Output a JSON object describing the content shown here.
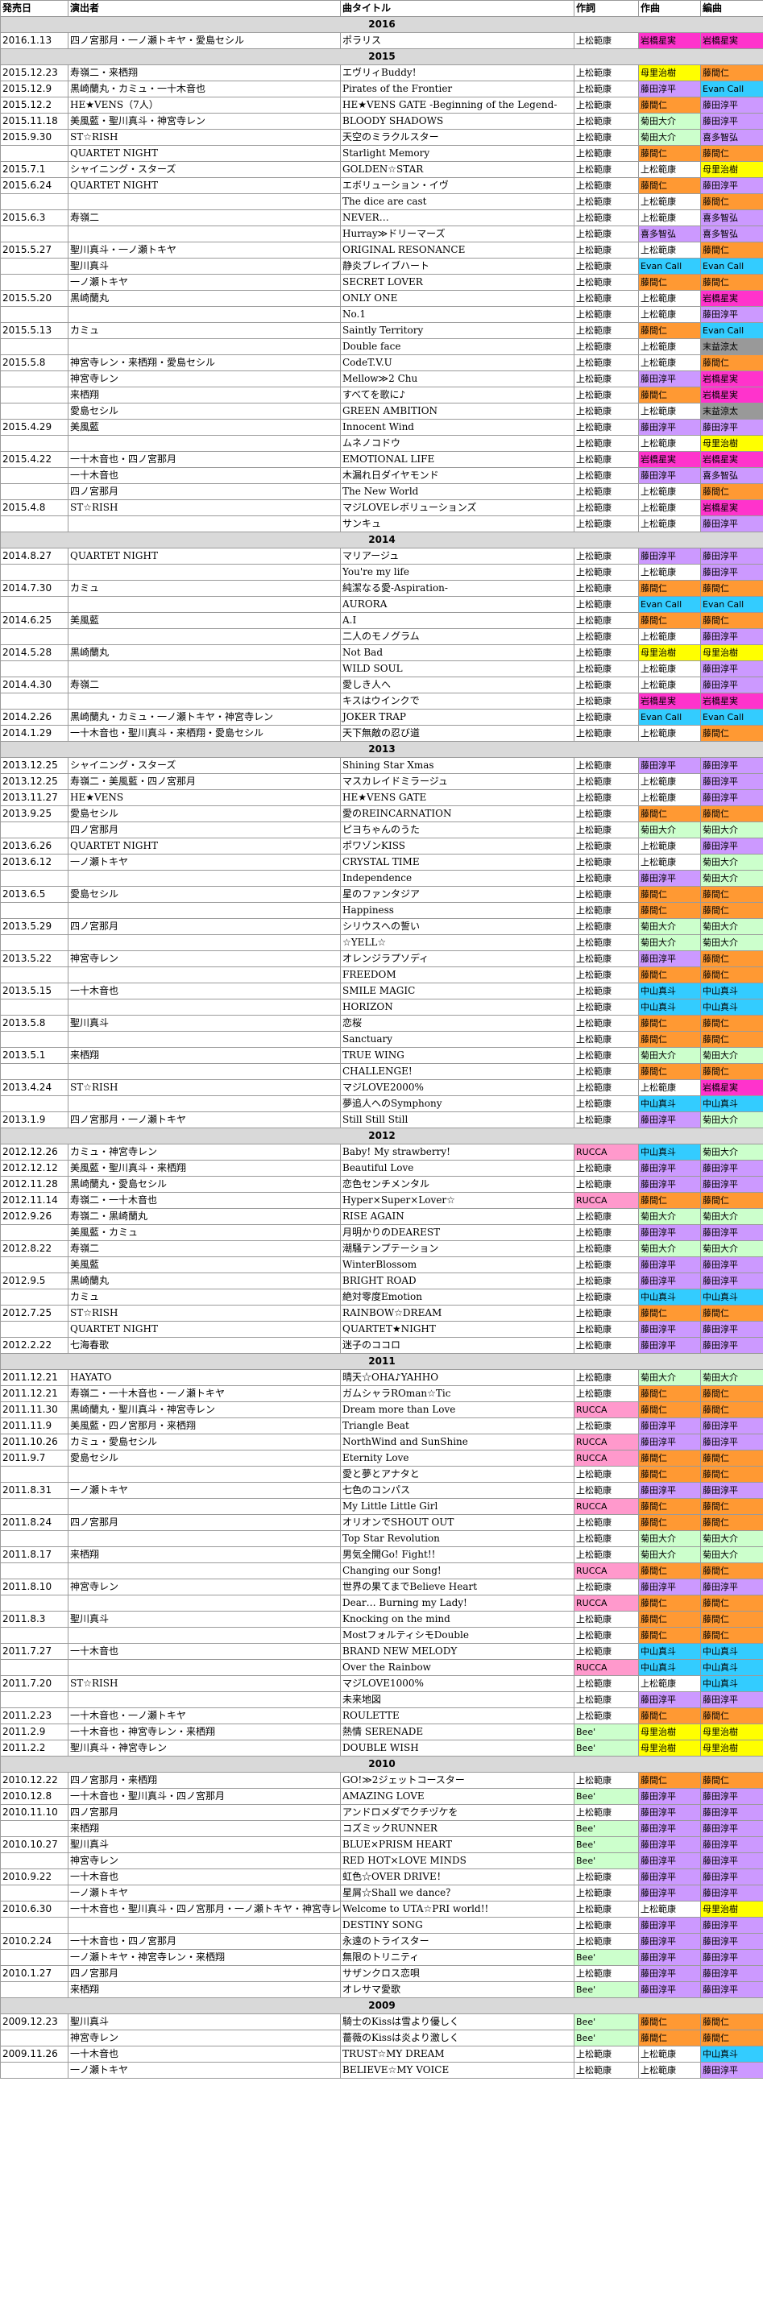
{
  "headers": [
    "発売日",
    "演出者",
    "曲タイトル",
    "作詞",
    "作曲",
    "編曲"
  ],
  "colors": {
    "上松範康": "#ffffff",
    "岩橋星実": "#ff33cc",
    "藤間仁": "#ff9933",
    "藤田淳平": "#cc99ff",
    "Evan Call": "#33ccff",
    "母里治樹": "#ffff00",
    "喜多智弘": "#cc99ff",
    "菊田大介": "#ccffcc",
    "末益涼太": "#999999",
    "中山真斗": "#33ccff",
    "RUCCA": "#ff99cc",
    "Bee'": "#ccffcc"
  },
  "groups": [
    {
      "year": "2016",
      "rows": [
        [
          "2016.1.13",
          "四ノ宮那月・一ノ瀬トキヤ・愛島セシル",
          "ポラリス",
          "上松範康",
          "岩橋星実",
          "岩橋星実"
        ]
      ]
    },
    {
      "year": "2015",
      "rows": [
        [
          "2015.12.23",
          "寿嶺二・来栖翔",
          "エヴリィBuddy!",
          "上松範康",
          "母里治樹",
          "藤間仁"
        ],
        [
          "2015.12.9",
          "黒崎蘭丸・カミュ・一十木音也",
          "Pirates of the Frontier",
          "上松範康",
          "藤田淳平",
          "Evan Call"
        ],
        [
          "2015.12.2",
          "HE★VENS（7人）",
          "HE★VENS GATE -Beginning of the Legend-",
          "上松範康",
          "藤間仁",
          "藤田淳平"
        ],
        [
          "2015.11.18",
          "美風藍・聖川真斗・神宮寺レン",
          "BLOODY SHADOWS",
          "上松範康",
          "菊田大介",
          "藤田淳平"
        ],
        [
          "2015.9.30",
          "ST☆RISH",
          "天空のミラクルスター",
          "上松範康",
          "菊田大介",
          "喜多智弘"
        ],
        [
          "",
          "QUARTET NIGHT",
          "Starlight Memory",
          "上松範康",
          "藤間仁",
          "藤間仁"
        ],
        [
          "2015.7.1",
          "シャイニング・スターズ",
          "GOLDEN☆STAR",
          "上松範康",
          "上松範康",
          "母里治樹"
        ],
        [
          "2015.6.24",
          "QUARTET NIGHT",
          "エボリューション・イヴ",
          "上松範康",
          "藤間仁",
          "藤田淳平"
        ],
        [
          "",
          "",
          "The dice are cast",
          "上松範康",
          "上松範康",
          "藤間仁"
        ],
        [
          "2015.6.3",
          "寿嶺二",
          "NEVER…",
          "上松範康",
          "上松範康",
          "喜多智弘"
        ],
        [
          "",
          "",
          "Hurray≫ドリーマーズ",
          "上松範康",
          "喜多智弘",
          "喜多智弘"
        ],
        [
          "2015.5.27",
          "聖川真斗・一ノ瀬トキヤ",
          "ORIGINAL RESONANCE",
          "上松範康",
          "上松範康",
          "藤間仁"
        ],
        [
          "",
          "聖川真斗",
          "静炎ブレイブハート",
          "上松範康",
          "Evan Call",
          "Evan Call"
        ],
        [
          "",
          "一ノ瀬トキヤ",
          "SECRET LOVER",
          "上松範康",
          "藤間仁",
          "藤間仁"
        ],
        [
          "2015.5.20",
          "黒崎蘭丸",
          "ONLY ONE",
          "上松範康",
          "上松範康",
          "岩橋星実"
        ],
        [
          "",
          "",
          "No.1",
          "上松範康",
          "上松範康",
          "藤田淳平"
        ],
        [
          "2015.5.13",
          "カミュ",
          "Saintly Territory",
          "上松範康",
          "藤間仁",
          "Evan Call"
        ],
        [
          "",
          "",
          "Double face",
          "上松範康",
          "上松範康",
          "末益涼太"
        ],
        [
          "2015.5.8",
          "神宮寺レン・来栖翔・愛島セシル",
          "CodeT.V.U",
          "上松範康",
          "上松範康",
          "藤間仁"
        ],
        [
          "",
          "神宮寺レン",
          "Mellow≫2 Chu",
          "上松範康",
          "藤田淳平",
          "岩橋星実"
        ],
        [
          "",
          "来栖翔",
          "すべてを歌に♪",
          "上松範康",
          "藤間仁",
          "岩橋星実"
        ],
        [
          "",
          "愛島セシル",
          "GREEN AMBITION",
          "上松範康",
          "上松範康",
          "末益涼太"
        ],
        [
          "2015.4.29",
          "美風藍",
          "Innocent Wind",
          "上松範康",
          "藤田淳平",
          "藤田淳平"
        ],
        [
          "",
          "",
          "ムネノコドウ",
          "上松範康",
          "上松範康",
          "母里治樹"
        ],
        [
          "2015.4.22",
          "一十木音也・四ノ宮那月",
          "EMOTIONAL LIFE",
          "上松範康",
          "岩橋星実",
          "岩橋星実"
        ],
        [
          "",
          "一十木音也",
          "木漏れ日ダイヤモンド",
          "上松範康",
          "藤田淳平",
          "喜多智弘"
        ],
        [
          "",
          "四ノ宮那月",
          "The New World",
          "上松範康",
          "上松範康",
          "藤間仁"
        ],
        [
          "2015.4.8",
          "ST☆RISH",
          "マジLOVEレボリューションズ",
          "上松範康",
          "上松範康",
          "岩橋星実"
        ],
        [
          "",
          "",
          "サンキュ",
          "上松範康",
          "上松範康",
          "藤田淳平"
        ]
      ]
    },
    {
      "year": "2014",
      "rows": [
        [
          "2014.8.27",
          "QUARTET NIGHT",
          "マリアージュ",
          "上松範康",
          "藤田淳平",
          "藤田淳平"
        ],
        [
          "",
          "",
          "You're my life",
          "上松範康",
          "上松範康",
          "藤田淳平"
        ],
        [
          "2014.7.30",
          "カミュ",
          "純潔なる愛-Aspiration-",
          "上松範康",
          "藤間仁",
          "藤間仁"
        ],
        [
          "",
          "",
          "AURORA",
          "上松範康",
          "Evan Call",
          "Evan Call"
        ],
        [
          "2014.6.25",
          "美風藍",
          "A.I",
          "上松範康",
          "藤間仁",
          "藤間仁"
        ],
        [
          "",
          "",
          "二人のモノグラム",
          "上松範康",
          "上松範康",
          "藤田淳平"
        ],
        [
          "2014.5.28",
          "黒崎蘭丸",
          "Not Bad",
          "上松範康",
          "母里治樹",
          "母里治樹"
        ],
        [
          "",
          "",
          "WILD SOUL",
          "上松範康",
          "上松範康",
          "藤田淳平"
        ],
        [
          "2014.4.30",
          "寿嶺二",
          "愛しき人へ",
          "上松範康",
          "上松範康",
          "藤田淳平"
        ],
        [
          "",
          "",
          "キスはウインクで",
          "上松範康",
          "岩橋星実",
          "岩橋星実"
        ],
        [
          "2014.2.26",
          "黒崎蘭丸・カミュ・一ノ瀬トキヤ・神宮寺レン",
          "JOKER TRAP",
          "上松範康",
          "Evan Call",
          "Evan Call"
        ],
        [
          "2014.1.29",
          "一十木音也・聖川真斗・来栖翔・愛島セシル",
          "天下無敵の忍び道",
          "上松範康",
          "上松範康",
          "藤間仁"
        ]
      ]
    },
    {
      "year": "2013",
      "rows": [
        [
          "2013.12.25",
          "シャイニング・スターズ",
          "Shining Star Xmas",
          "上松範康",
          "藤田淳平",
          "藤田淳平"
        ],
        [
          "2013.12.25",
          "寿嶺二・美風藍・四ノ宮那月",
          "マスカレイドミラージュ",
          "上松範康",
          "上松範康",
          "藤田淳平"
        ],
        [
          "2013.11.27",
          "HE★VENS",
          "HE★VENS GATE",
          "上松範康",
          "上松範康",
          "藤田淳平"
        ],
        [
          "2013.9.25",
          "愛島セシル",
          "愛のREINCARNATION",
          "上松範康",
          "藤間仁",
          "藤間仁"
        ],
        [
          "",
          "四ノ宮那月",
          "ピヨちゃんのうた",
          "上松範康",
          "菊田大介",
          "菊田大介"
        ],
        [
          "2013.6.26",
          "QUARTET NIGHT",
          "ポワゾンKISS",
          "上松範康",
          "上松範康",
          "藤田淳平"
        ],
        [
          "2013.6.12",
          "一ノ瀬トキヤ",
          "CRYSTAL TIME",
          "上松範康",
          "上松範康",
          "菊田大介"
        ],
        [
          "",
          "",
          "Independence",
          "上松範康",
          "藤田淳平",
          "菊田大介"
        ],
        [
          "2013.6.5",
          "愛島セシル",
          "星のファンタジア",
          "上松範康",
          "藤間仁",
          "藤間仁"
        ],
        [
          "",
          "",
          "Happiness",
          "上松範康",
          "藤間仁",
          "藤間仁"
        ],
        [
          "2013.5.29",
          "四ノ宮那月",
          "シリウスへの誓い",
          "上松範康",
          "菊田大介",
          "菊田大介"
        ],
        [
          "",
          "",
          "☆YELL☆",
          "上松範康",
          "菊田大介",
          "菊田大介"
        ],
        [
          "2013.5.22",
          "神宮寺レン",
          "オレンジラプソディ",
          "上松範康",
          "藤田淳平",
          "藤間仁"
        ],
        [
          "",
          "",
          "FREEDOM",
          "上松範康",
          "藤間仁",
          "藤間仁"
        ],
        [
          "2013.5.15",
          "一十木音也",
          "SMILE MAGIC",
          "上松範康",
          "中山真斗",
          "中山真斗"
        ],
        [
          "",
          "",
          "HORIZON",
          "上松範康",
          "中山真斗",
          "中山真斗"
        ],
        [
          "2013.5.8",
          "聖川真斗",
          "恋桜",
          "上松範康",
          "藤間仁",
          "藤間仁"
        ],
        [
          "",
          "",
          "Sanctuary",
          "上松範康",
          "藤間仁",
          "藤間仁"
        ],
        [
          "2013.5.1",
          "来栖翔",
          "TRUE WING",
          "上松範康",
          "菊田大介",
          "菊田大介"
        ],
        [
          "",
          "",
          "CHALLENGE!",
          "上松範康",
          "藤間仁",
          "藤間仁"
        ],
        [
          "2013.4.24",
          "ST☆RISH",
          "マジLOVE2000%",
          "上松範康",
          "上松範康",
          "岩橋星実"
        ],
        [
          "",
          "",
          "夢追人へのSymphony",
          "上松範康",
          "中山真斗",
          "中山真斗"
        ],
        [
          "2013.1.9",
          "四ノ宮那月・一ノ瀬トキヤ",
          "Still Still Still",
          "上松範康",
          "藤田淳平",
          "菊田大介"
        ]
      ]
    },
    {
      "year": "2012",
      "rows": [
        [
          "2012.12.26",
          "カミュ・神宮寺レン",
          "Baby! My strawberry!",
          "RUCCA",
          "中山真斗",
          "菊田大介"
        ],
        [
          "2012.12.12",
          "美風藍・聖川真斗・来栖翔",
          "Beautiful Love",
          "上松範康",
          "藤田淳平",
          "藤田淳平"
        ],
        [
          "2012.11.28",
          "黒崎蘭丸・愛島セシル",
          "恋色センチメンタル",
          "上松範康",
          "藤田淳平",
          "藤田淳平"
        ],
        [
          "2012.11.14",
          "寿嶺二・一十木音也",
          "Hyper×Super×Lover☆",
          "RUCCA",
          "藤間仁",
          "藤間仁"
        ],
        [
          "2012.9.26",
          "寿嶺二・黒崎蘭丸",
          "RISE AGAIN",
          "上松範康",
          "菊田大介",
          "菊田大介"
        ],
        [
          "",
          "美風藍・カミュ",
          "月明かりのDEAREST",
          "上松範康",
          "藤田淳平",
          "藤田淳平"
        ],
        [
          "2012.8.22",
          "寿嶺二",
          "潮騒テンプテーション",
          "上松範康",
          "菊田大介",
          "菊田大介"
        ],
        [
          "",
          "美風藍",
          "WinterBlossom",
          "上松範康",
          "藤田淳平",
          "藤田淳平"
        ],
        [
          "2012.9.5",
          "黒崎蘭丸",
          "BRIGHT ROAD",
          "上松範康",
          "藤田淳平",
          "藤田淳平"
        ],
        [
          "",
          "カミュ",
          "絶対零度Emotion",
          "上松範康",
          "中山真斗",
          "中山真斗"
        ],
        [
          "2012.7.25",
          "ST☆RISH",
          "RAINBOW☆DREAM",
          "上松範康",
          "藤間仁",
          "藤間仁"
        ],
        [
          "",
          "QUARTET NIGHT",
          "QUARTET★NIGHT",
          "上松範康",
          "藤田淳平",
          "藤田淳平"
        ],
        [
          "2012.2.22",
          "七海春歌",
          "迷子のココロ",
          "上松範康",
          "藤田淳平",
          "藤田淳平"
        ]
      ]
    },
    {
      "year": "2011",
      "rows": [
        [
          "2011.12.21",
          "HAYATO",
          "晴天☆OHA♪YAHHO",
          "上松範康",
          "菊田大介",
          "菊田大介"
        ],
        [
          "2011.12.21",
          "寿嶺二・一十木音也・一ノ瀬トキヤ",
          "ガムシャラROman☆Tic",
          "上松範康",
          "藤間仁",
          "藤間仁"
        ],
        [
          "2011.11.30",
          "黒崎蘭丸・聖川真斗・神宮寺レン",
          "Dream more than Love",
          "RUCCA",
          "藤間仁",
          "藤間仁"
        ],
        [
          "2011.11.9",
          "美風藍・四ノ宮那月・来栖翔",
          "Triangle Beat",
          "上松範康",
          "藤田淳平",
          "藤田淳平"
        ],
        [
          "2011.10.26",
          "カミュ・愛島セシル",
          "NorthWind and SunShine",
          "RUCCA",
          "藤田淳平",
          "藤田淳平"
        ],
        [
          "2011.9.7",
          "愛島セシル",
          "Eternity Love",
          "RUCCA",
          "藤間仁",
          "藤間仁"
        ],
        [
          "",
          "",
          "愛と夢とアナタと",
          "上松範康",
          "藤間仁",
          "藤間仁"
        ],
        [
          "2011.8.31",
          "一ノ瀬トキヤ",
          "七色のコンパス",
          "上松範康",
          "藤田淳平",
          "藤田淳平"
        ],
        [
          "",
          "",
          "My Little Little Girl",
          "RUCCA",
          "藤間仁",
          "藤間仁"
        ],
        [
          "2011.8.24",
          "四ノ宮那月",
          "オリオンでSHOUT OUT",
          "上松範康",
          "藤間仁",
          "藤間仁"
        ],
        [
          "",
          "",
          "Top Star Revolution",
          "上松範康",
          "菊田大介",
          "菊田大介"
        ],
        [
          "2011.8.17",
          "来栖翔",
          "男気全開Go! Fight!!",
          "上松範康",
          "菊田大介",
          "菊田大介"
        ],
        [
          "",
          "",
          "Changing our Song!",
          "RUCCA",
          "藤間仁",
          "藤間仁"
        ],
        [
          "2011.8.10",
          "神宮寺レン",
          "世界の果てまでBelieve Heart",
          "上松範康",
          "藤田淳平",
          "藤田淳平"
        ],
        [
          "",
          "",
          "Dear… Burning my Lady!",
          "RUCCA",
          "藤間仁",
          "藤間仁"
        ],
        [
          "2011.8.3",
          "聖川真斗",
          "Knocking on the mind",
          "上松範康",
          "藤間仁",
          "藤間仁"
        ],
        [
          "",
          "",
          "MostフォルティシモDouble",
          "上松範康",
          "藤間仁",
          "藤間仁"
        ],
        [
          "2011.7.27",
          "一十木音也",
          "BRAND NEW MELODY",
          "上松範康",
          "中山真斗",
          "中山真斗"
        ],
        [
          "",
          "",
          "Over the Rainbow",
          "RUCCA",
          "中山真斗",
          "中山真斗"
        ],
        [
          "2011.7.20",
          "ST☆RISH",
          "マジLOVE1000%",
          "上松範康",
          "上松範康",
          "中山真斗"
        ],
        [
          "",
          "",
          "未来地図",
          "上松範康",
          "藤田淳平",
          "藤田淳平"
        ],
        [
          "2011.2.23",
          "一十木音也・一ノ瀬トキヤ",
          "ROULETTE",
          "上松範康",
          "藤間仁",
          "藤間仁"
        ],
        [
          "2011.2.9",
          "一十木音也・神宮寺レン・来栖翔",
          "熱情 SERENADE",
          "Bee'",
          "母里治樹",
          "母里治樹"
        ],
        [
          "2011.2.2",
          "聖川真斗・神宮寺レン",
          "DOUBLE WISH",
          "Bee'",
          "母里治樹",
          "母里治樹"
        ]
      ]
    },
    {
      "year": "2010",
      "rows": [
        [
          "2010.12.22",
          "四ノ宮那月・来栖翔",
          "GO!≫2ジェットコースター",
          "上松範康",
          "藤間仁",
          "藤間仁"
        ],
        [
          "2010.12.8",
          "一十木音也・聖川真斗・四ノ宮那月",
          "AMAZING LOVE",
          "Bee'",
          "藤田淳平",
          "藤田淳平"
        ],
        [
          "2010.11.10",
          "四ノ宮那月",
          "アンドロメダでクチヅケを",
          "上松範康",
          "藤田淳平",
          "藤田淳平"
        ],
        [
          "",
          "来栖翔",
          "コズミックRUNNER",
          "Bee'",
          "藤田淳平",
          "藤田淳平"
        ],
        [
          "2010.10.27",
          "聖川真斗",
          "BLUE×PRISM HEART",
          "Bee'",
          "藤田淳平",
          "藤田淳平"
        ],
        [
          "",
          "神宮寺レン",
          "RED HOT×LOVE MINDS",
          "Bee'",
          "藤田淳平",
          "藤田淳平"
        ],
        [
          "2010.9.22",
          "一十木音也",
          "虹色☆OVER DRIVE！",
          "上松範康",
          "藤田淳平",
          "藤田淳平"
        ],
        [
          "",
          "一ノ瀬トキヤ",
          "星屑☆Shall we dance？",
          "上松範康",
          "藤田淳平",
          "藤田淳平"
        ],
        [
          "2010.6.30",
          "一十木音也・聖川真斗・四ノ宮那月・一ノ瀬トキヤ・神宮寺レン・来栖翔",
          "Welcome to UTA☆PRI world!!",
          "上松範康",
          "上松範康",
          "母里治樹"
        ],
        [
          "",
          "",
          "DESTINY SONG",
          "上松範康",
          "藤田淳平",
          "藤田淳平"
        ],
        [
          "2010.2.24",
          "一十木音也・四ノ宮那月",
          "永遠のトライスター",
          "上松範康",
          "藤田淳平",
          "藤田淳平"
        ],
        [
          "",
          "一ノ瀬トキヤ・神宮寺レン・来栖翔",
          "無限のトリニティ",
          "Bee'",
          "藤田淳平",
          "藤田淳平"
        ],
        [
          "2010.1.27",
          "四ノ宮那月",
          "サザンクロス恋唄",
          "上松範康",
          "藤田淳平",
          "藤田淳平"
        ],
        [
          "",
          "来栖翔",
          "オレサマ愛歌",
          "Bee'",
          "藤田淳平",
          "藤田淳平"
        ]
      ]
    },
    {
      "year": "2009",
      "rows": [
        [
          "2009.12.23",
          "聖川真斗",
          "騎士のKissは雪より優しく",
          "Bee'",
          "藤間仁",
          "藤間仁"
        ],
        [
          "",
          "神宮寺レン",
          "薔薇のKissは炎より激しく",
          "Bee'",
          "藤間仁",
          "藤間仁"
        ],
        [
          "2009.11.26",
          "一十木音也",
          "TRUST☆MY DREAM",
          "上松範康",
          "上松範康",
          "中山真斗"
        ],
        [
          "",
          "一ノ瀬トキヤ",
          "BELIEVE☆MY VOICE",
          "上松範康",
          "上松範康",
          "藤田淳平"
        ]
      ]
    }
  ]
}
